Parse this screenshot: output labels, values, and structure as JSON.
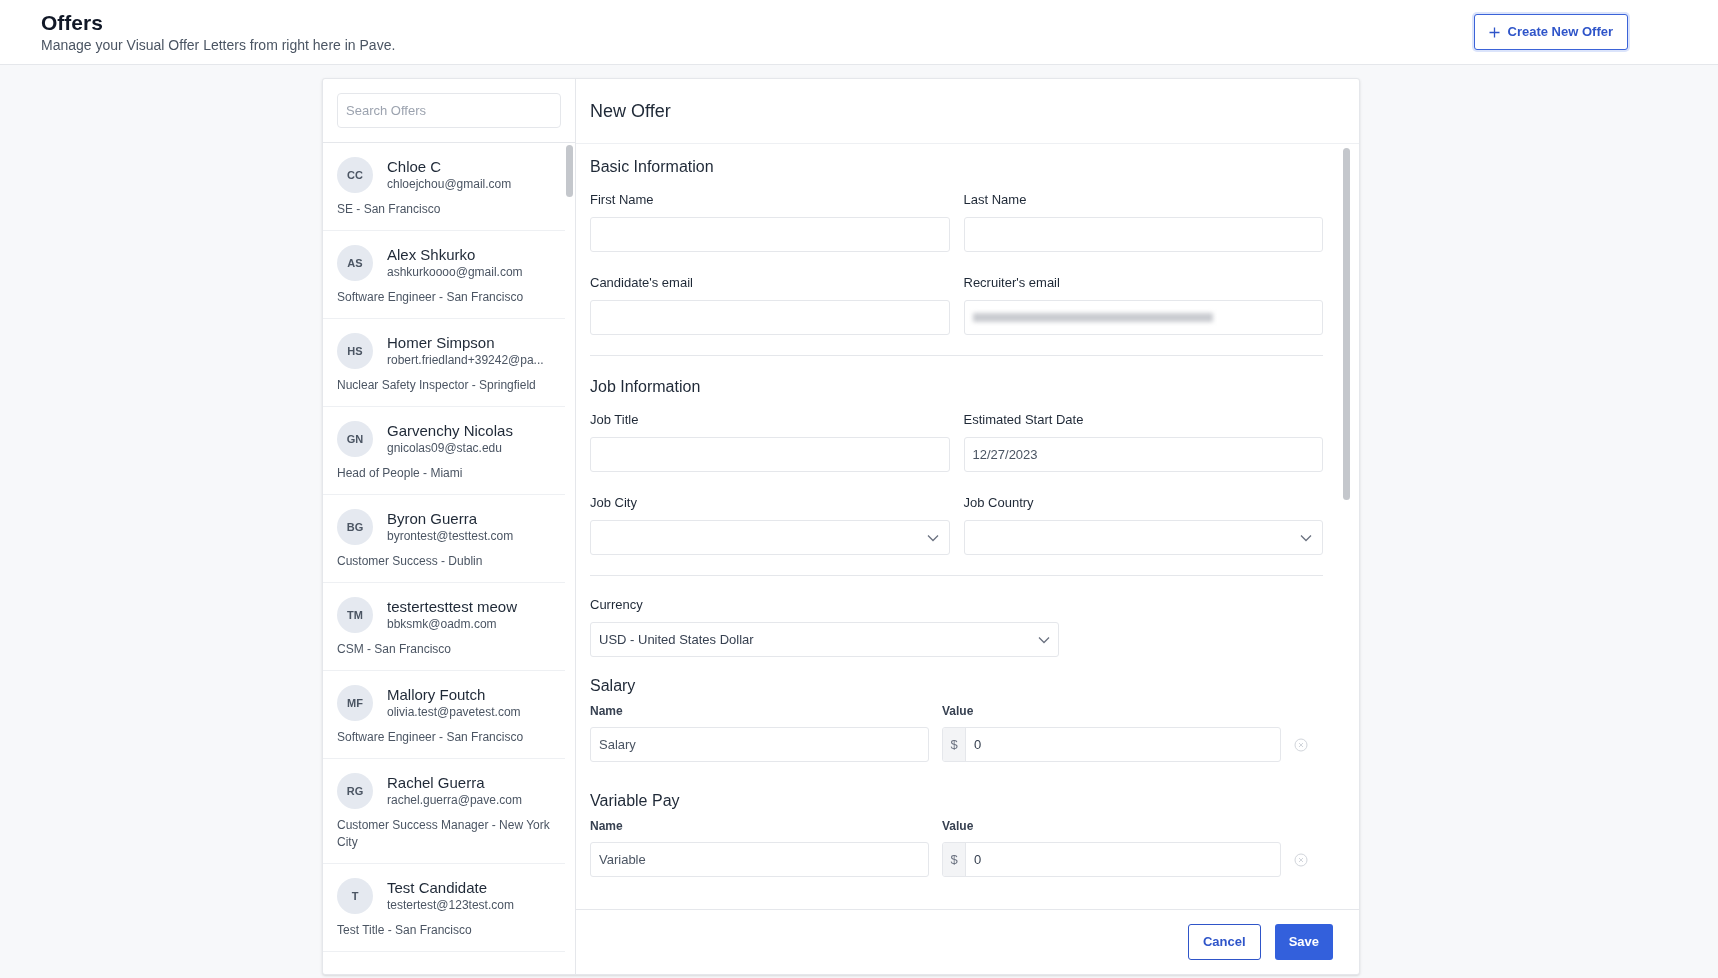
{
  "header": {
    "title": "Offers",
    "subtitle": "Manage your Visual Offer Letters from right here in Pave.",
    "create_button": "Create New Offer"
  },
  "offers": {
    "search": {
      "placeholder": "Search Offers"
    },
    "items": [
      {
        "initials": "CC",
        "name": "Chloe C",
        "email": "chloejchou@gmail.com",
        "role": "SE - San Francisco"
      },
      {
        "initials": "AS",
        "name": "Alex Shkurko",
        "email": "ashkurkoooo@gmail.com",
        "role": "Software Engineer - San Francisco"
      },
      {
        "initials": "HS",
        "name": "Homer Simpson",
        "email": "robert.friedland+39242@pa...",
        "role": "Nuclear Safety Inspector - Springfield"
      },
      {
        "initials": "GN",
        "name": "Garvenchy Nicolas",
        "email": "gnicolas09@stac.edu",
        "role": "Head of People - Miami"
      },
      {
        "initials": "BG",
        "name": "Byron Guerra",
        "email": "byrontest@testtest.com",
        "role": "Customer Success - Dublin"
      },
      {
        "initials": "TM",
        "name": "testertesttest meow",
        "email": "bbksmk@oadm.com",
        "role": "CSM - San Francisco"
      },
      {
        "initials": "MF",
        "name": "Mallory Foutch",
        "email": "olivia.test@pavetest.com",
        "role": "Software Engineer - San Francisco"
      },
      {
        "initials": "RG",
        "name": "Rachel Guerra",
        "email": "rachel.guerra@pave.com",
        "role": "Customer Success Manager - New York City"
      },
      {
        "initials": "T",
        "name": "Test Candidate",
        "email": "testertest@123test.com",
        "role": "Test Title - San Francisco"
      }
    ]
  },
  "form": {
    "title": "New Offer",
    "sections": [
      {
        "heading": "Basic Information",
        "fields": [
          {
            "label": "First Name",
            "kind": "text"
          },
          {
            "label": "Last Name",
            "kind": "text"
          },
          {
            "label": "Candidate's email",
            "kind": "text"
          },
          {
            "label": "Recruiter's email",
            "kind": "redacted"
          }
        ]
      },
      {
        "heading": "Job Information",
        "fields": [
          {
            "label": "Job Title",
            "kind": "text"
          },
          {
            "label": "Estimated Start Date",
            "kind": "text",
            "value": "12/27/2023"
          },
          {
            "label": "Job City",
            "kind": "select"
          },
          {
            "label": "Job Country",
            "kind": "select"
          }
        ]
      }
    ],
    "currency": {
      "label": "Currency",
      "value": "USD - United States Dollar"
    },
    "pay_sections": [
      {
        "heading": "Salary",
        "name_label": "Name",
        "value_label": "Value",
        "name_value": "Salary",
        "currency_symbol": "$",
        "amount": "0"
      },
      {
        "heading": "Variable Pay",
        "name_label": "Name",
        "value_label": "Value",
        "name_value": "Variable",
        "currency_symbol": "$",
        "amount": "0"
      }
    ],
    "buttons": {
      "cancel": "Cancel",
      "save": "Save"
    }
  }
}
